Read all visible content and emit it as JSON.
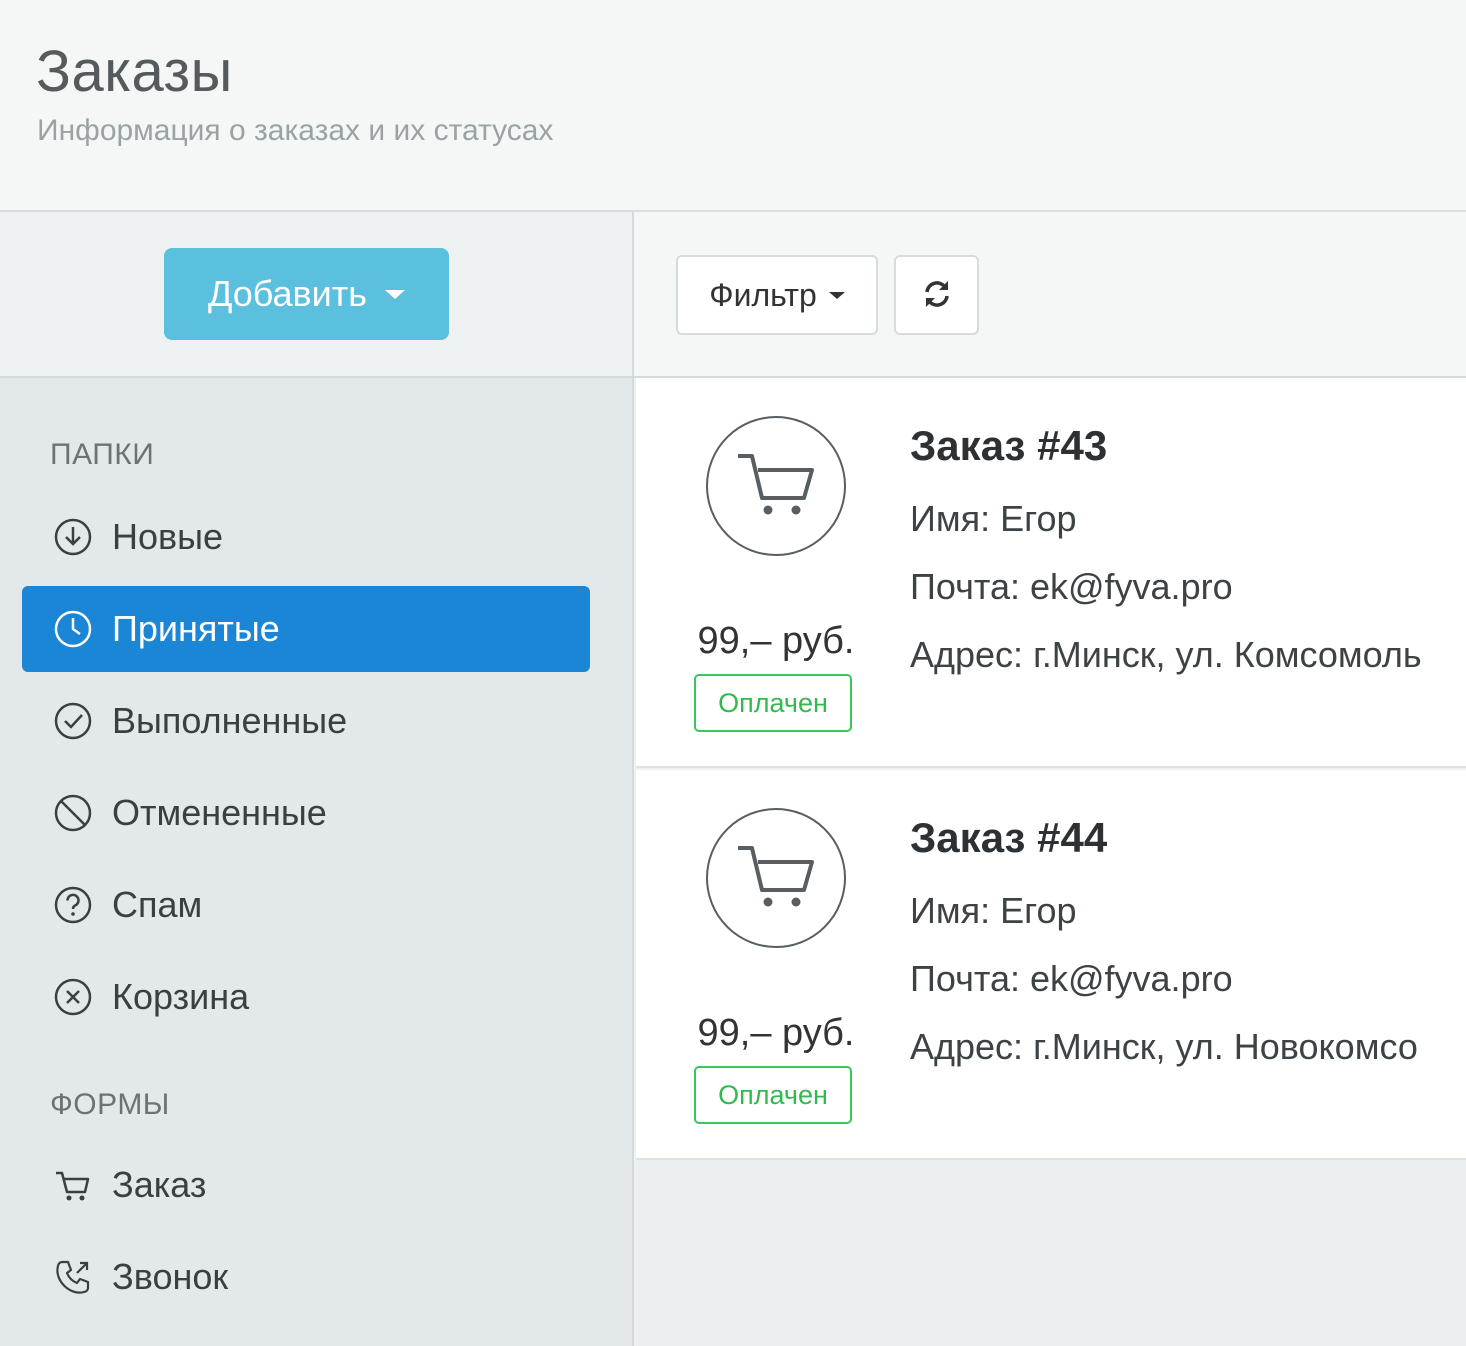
{
  "header": {
    "title": "Заказы",
    "subtitle": "Информация о заказах и их статусах"
  },
  "sidebar": {
    "add_button_label": "Добавить",
    "folders_header": "ПАПКИ",
    "folders": [
      {
        "label": "Новые",
        "icon": "arrow-down-circle-icon"
      },
      {
        "label": "Принятые",
        "icon": "clock-icon",
        "active": true
      },
      {
        "label": "Выполненные",
        "icon": "check-circle-icon"
      },
      {
        "label": "Отмененные",
        "icon": "ban-icon"
      },
      {
        "label": "Спам",
        "icon": "question-circle-icon"
      },
      {
        "label": "Корзина",
        "icon": "x-circle-icon"
      }
    ],
    "forms_header": "ФОРМЫ",
    "forms": [
      {
        "label": "Заказ",
        "icon": "cart-icon"
      },
      {
        "label": "Звонок",
        "icon": "phone-icon"
      }
    ]
  },
  "toolbar": {
    "filter_label": "Фильтр"
  },
  "orders": [
    {
      "title": "Заказ #43",
      "name": "Имя: Егор",
      "email": "Почта: ek@fyva.pro",
      "address": "Адрес: г.Минск, ул. Комсомоль",
      "price": "99,– руб.",
      "status": "Оплачен"
    },
    {
      "title": "Заказ #44",
      "name": "Имя: Егор",
      "email": "Почта: ek@fyva.pro",
      "address": "Адрес: г.Минск, ул. Новокомсо",
      "price": "99,– руб.",
      "status": "Оплачен"
    }
  ],
  "colors": {
    "accent": "#1c86d6",
    "add_button": "#5bc0de",
    "paid_badge": "#3cc65a"
  }
}
